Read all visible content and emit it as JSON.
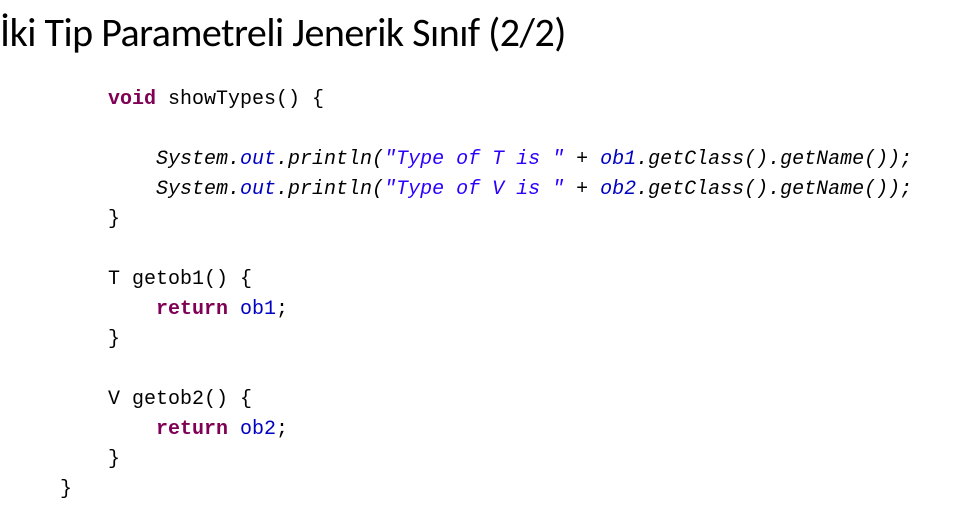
{
  "title": "İki Tip Parametreli Jenerik Sınıf (2/2)",
  "code": {
    "l1a": "void",
    "l1b": " showTypes() {",
    "l2a": "System.",
    "l2b": "out",
    "l2c": ".println(",
    "l2d": "\"Type of T is \"",
    "l2e": " + ",
    "l2f": "ob1",
    "l2g": ".getClass().getName());",
    "l3a": "System.",
    "l3b": "out",
    "l3c": ".println(",
    "l3d": "\"Type of V is \"",
    "l3e": " + ",
    "l3f": "ob2",
    "l3g": ".getClass().getName());",
    "l4": "}",
    "l5": "T getob1() {",
    "l6a": "return",
    "l6b": " ",
    "l6c": "ob1",
    "l6d": ";",
    "l7": "}",
    "l8": "V getob2() {",
    "l9a": "return",
    "l9b": " ",
    "l9c": "ob2",
    "l9d": ";",
    "l10": "}",
    "l11": "}"
  }
}
